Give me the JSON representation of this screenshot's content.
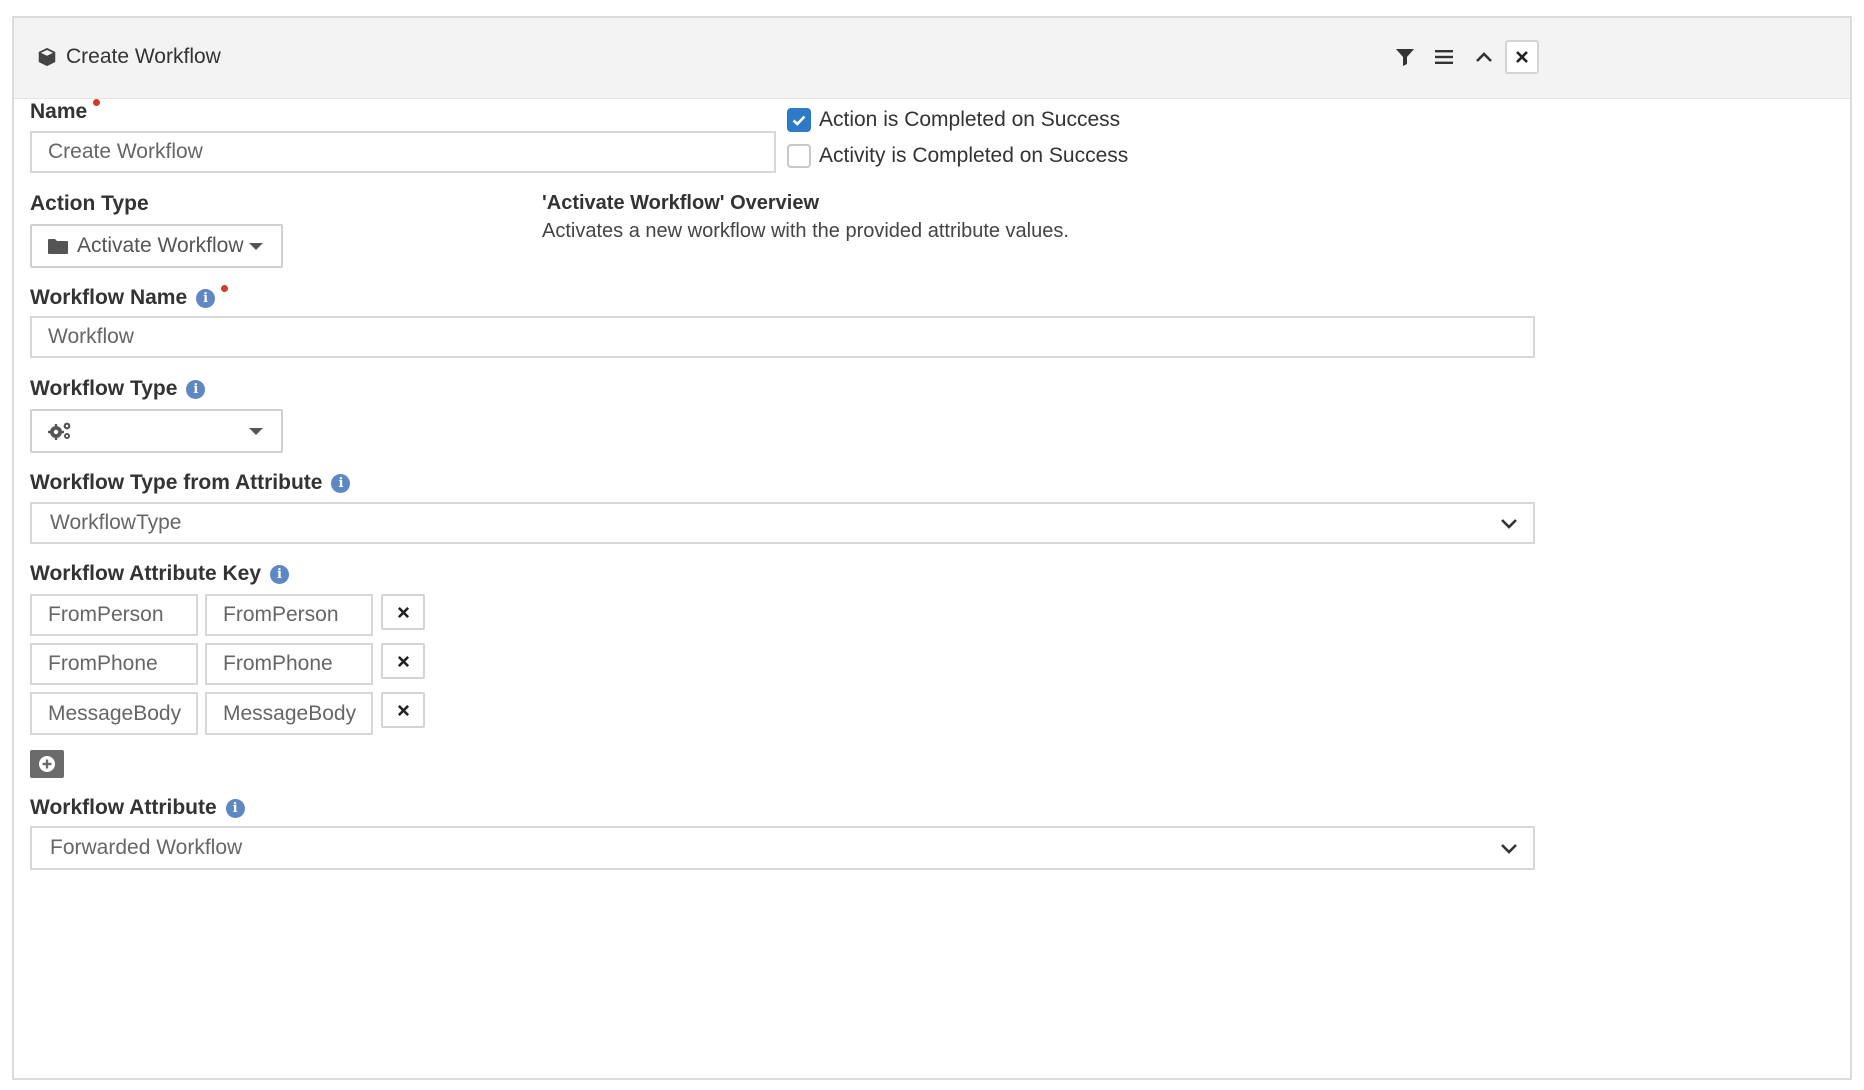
{
  "panel": {
    "title": "Create Workflow"
  },
  "form": {
    "name": {
      "label": "Name",
      "value": "Create Workflow"
    },
    "checks": [
      {
        "label": "Action is Completed on Success",
        "checked": true
      },
      {
        "label": "Activity is Completed on Success",
        "checked": false
      }
    ],
    "action_type": {
      "label": "Action Type",
      "value": "Activate Workflow"
    },
    "overview": {
      "title": "'Activate Workflow' Overview",
      "text": "Activates a new workflow with the provided attribute values."
    },
    "workflow_name": {
      "label": "Workflow Name",
      "value": "Workflow"
    },
    "workflow_type": {
      "label": "Workflow Type"
    },
    "workflow_type_from_attribute": {
      "label": "Workflow Type from Attribute",
      "value": "WorkflowType"
    },
    "workflow_attribute_key": {
      "label": "Workflow Attribute Key",
      "rows": [
        {
          "key": "FromPerson",
          "value": "FromPerson"
        },
        {
          "key": "FromPhone",
          "value": "FromPhone"
        },
        {
          "key": "MessageBody",
          "value": "MessageBody"
        }
      ]
    },
    "workflow_attribute": {
      "label": "Workflow Attribute",
      "value": "Forwarded Workflow"
    }
  },
  "colors": {
    "accent": "#2d7ac8",
    "required": "#cf3c27",
    "info": "#5f87c4"
  }
}
